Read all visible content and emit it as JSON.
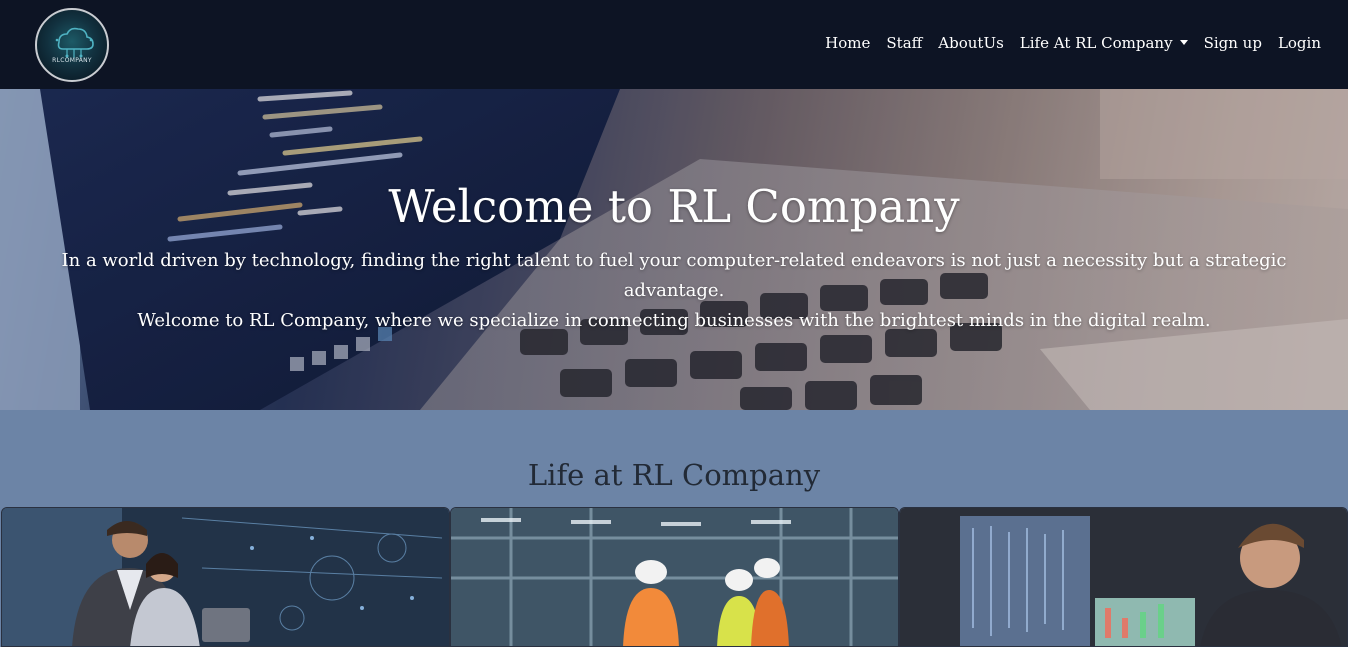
{
  "logo": {
    "text": "RLCOMPANY"
  },
  "nav": {
    "items": [
      {
        "label": "Home"
      },
      {
        "label": "Staff"
      },
      {
        "label": "AboutUs"
      },
      {
        "label": "Life At RL Company",
        "dropdown": true
      },
      {
        "label": "Sign up"
      },
      {
        "label": "Login"
      }
    ]
  },
  "hero": {
    "title": "Welcome to RL Company",
    "line1": "In a world driven by technology, finding the right talent to fuel your computer-related endeavors is not just a necessity but a strategic advantage.",
    "line2": "Welcome to RL Company, where we specialize in connecting businesses with the brightest minds in the digital realm."
  },
  "life": {
    "title": "Life at RL Company",
    "cards": [
      {
        "image": "team-datacenter-photo"
      },
      {
        "image": "factory-engineers-photo"
      },
      {
        "image": "trader-monitors-photo"
      }
    ]
  },
  "colors": {
    "navbar_bg": "#0d1424",
    "section_bg": "#6c84a6",
    "text_light": "#ffffff",
    "text_dark": "#222a36"
  }
}
